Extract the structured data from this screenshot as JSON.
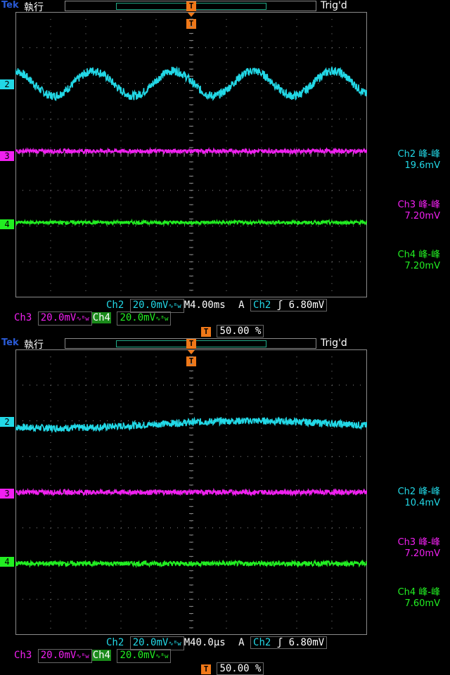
{
  "colors": {
    "ch2": "#22d8e6",
    "ch3": "#f020f0",
    "ch4": "#22ee22",
    "trigger": "#f07818",
    "grid": "#8a8a8a"
  },
  "screens": [
    {
      "header": {
        "brand": "Tek",
        "mode": "執行",
        "trig_status": "Trig'd"
      },
      "trigger_marker": "T",
      "measurements": [
        {
          "label": "Ch2 峰-峰",
          "value": "19.6mV"
        },
        {
          "label": "Ch3 峰-峰",
          "value": "7.20mV"
        },
        {
          "label": "Ch4 峰-峰",
          "value": "7.20mV"
        }
      ],
      "status": {
        "ch2_label": "Ch2",
        "ch2_scale": "20.0mV",
        "timebase": "M4.00ms",
        "trig_mode": "A",
        "trig_src": "Ch2",
        "trig_slope": "ʃ",
        "trig_level": "6.80mV",
        "ch3_label": "Ch3",
        "ch3_scale": "20.0mV",
        "ch4_label": "Ch4",
        "ch4_scale": "20.0mV",
        "trig_pos": "50.00 %",
        "bw_symbol": "∿ᴮw"
      }
    },
    {
      "header": {
        "brand": "Tek",
        "mode": "執行",
        "trig_status": "Trig'd"
      },
      "trigger_marker": "T",
      "measurements": [
        {
          "label": "Ch2 峰-峰",
          "value": "10.4mV"
        },
        {
          "label": "Ch3 峰-峰",
          "value": "7.20mV"
        },
        {
          "label": "Ch4 峰-峰",
          "value": "7.60mV"
        }
      ],
      "status": {
        "ch2_label": "Ch2",
        "ch2_scale": "20.0mV",
        "timebase": "M40.0µs",
        "trig_mode": "A",
        "trig_src": "Ch2",
        "trig_slope": "ʃ",
        "trig_level": "6.80mV",
        "ch3_label": "Ch3",
        "ch3_scale": "20.0mV",
        "ch4_label": "Ch4",
        "ch4_scale": "20.0mV",
        "trig_pos": "50.00 %",
        "bw_symbol": "∿ᴮw"
      }
    }
  ],
  "chart_data": [
    {
      "type": "line",
      "x_divisions": 10,
      "y_divisions": 8,
      "ylim": [
        -4,
        4
      ],
      "grid": true,
      "series": [
        {
          "name": "2",
          "offset_div": 2.0,
          "shape": "sine",
          "cycles": 4.4,
          "amplitude_div": 0.35,
          "noise_div": 0.12,
          "pp": "19.6mV"
        },
        {
          "name": "3",
          "offset_div": 0.1,
          "shape": "flat",
          "noise_div": 0.06,
          "pp": "7.20mV"
        },
        {
          "name": "4",
          "offset_div": -1.9,
          "shape": "flat",
          "noise_div": 0.05,
          "pp": "7.20mV"
        }
      ]
    },
    {
      "type": "line",
      "x_divisions": 10,
      "y_divisions": 8,
      "ylim": [
        -4,
        4
      ],
      "grid": true,
      "series": [
        {
          "name": "2",
          "offset_div": 1.9,
          "shape": "slow",
          "cycles": 0.9,
          "amplitude_div": 0.1,
          "noise_div": 0.1,
          "pp": "10.4mV"
        },
        {
          "name": "3",
          "offset_div": 0.0,
          "shape": "flat",
          "noise_div": 0.07,
          "pp": "7.20mV"
        },
        {
          "name": "4",
          "offset_div": -2.0,
          "shape": "flat",
          "noise_div": 0.07,
          "pp": "7.60mV"
        }
      ]
    }
  ]
}
